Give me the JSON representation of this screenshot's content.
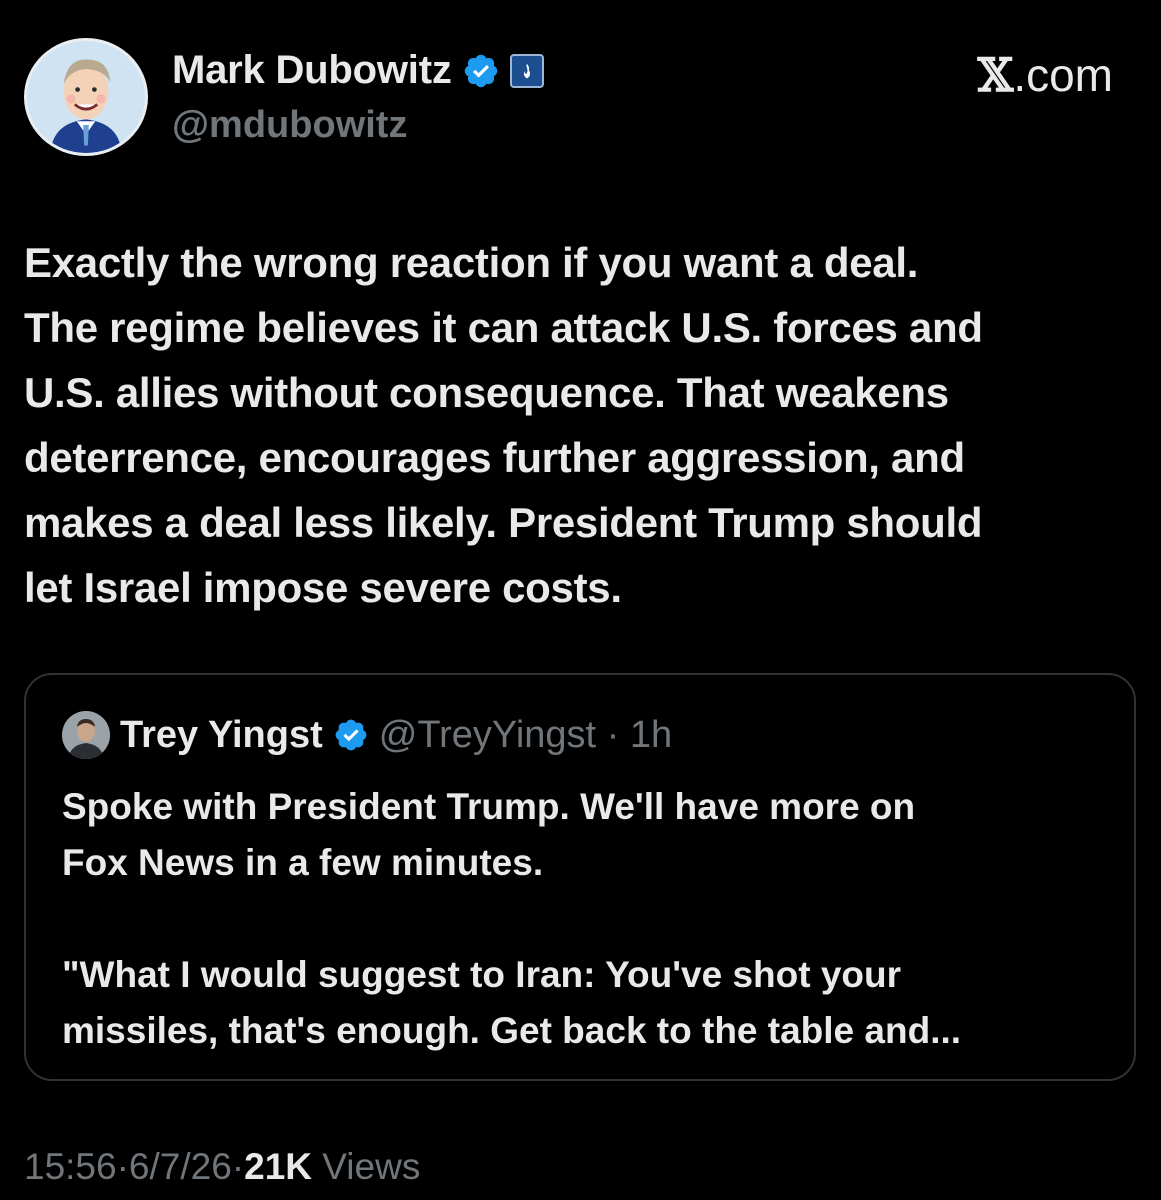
{
  "author": {
    "display_name": "Mark Dubowitz",
    "handle": "@mdubowitz",
    "verified_color": "#1d9bf0",
    "avatar_icon": "cartoon-portrait",
    "affiliation_icon": "flame-badge"
  },
  "brand": {
    "label": ".com",
    "logo_glyph": "𝕏"
  },
  "post": {
    "text": "Exactly the wrong reaction if you want a deal.\nThe regime believes it can attack U.S. forces and\nU.S. allies without consequence. That weakens\ndeterrence, encourages further aggression, and\nmakes a deal less likely. President Trump should\nlet Israel impose severe costs."
  },
  "quoted": {
    "display_name": "Trey Yingst",
    "handle": "@TreyYingst",
    "separator": " · ",
    "time": "1h",
    "text": "Spoke with President Trump. We'll have more on\nFox News in a few minutes.\n\n\"What I would suggest to Iran: You've shot your\nmissiles, that's enough. Get back to the table and..."
  },
  "footer": {
    "time": "15:56",
    "date": "6/7/26",
    "views_count": "21K",
    "views_label": " Views",
    "separator": " · "
  }
}
